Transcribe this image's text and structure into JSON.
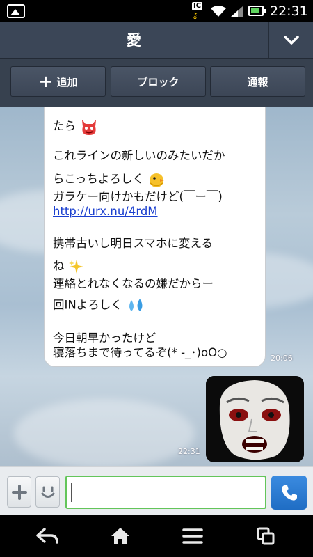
{
  "status_bar": {
    "ic_badge": "IC",
    "time": "22:31",
    "icons": [
      "image-notification-icon",
      "key-icon",
      "wifi-icon",
      "signal-icon",
      "battery-icon"
    ]
  },
  "header": {
    "title": "愛",
    "menu_icon": "chevron-down-icon"
  },
  "actions": {
    "add_label": "追加",
    "block_label": "ブロック",
    "report_label": "通報"
  },
  "messages": [
    {
      "side": "left",
      "lines": [
        "たら",
        "これラインの新しいのみたいだか",
        "らこっちよろしく",
        "ガラケー向けかもだけど(￣ー￣)",
        "http://urx.nu/4rdM",
        "携帯古いし明日スマホに変える",
        "ね",
        "連絡とれなくなるの嫌だからー",
        "回INよろしく",
        "今日朝早かったけど",
        "寝落ちまで待ってるぞ(* -_･)oO○"
      ],
      "time": "20:06"
    },
    {
      "side": "right",
      "type": "image",
      "time": "22:31"
    }
  ],
  "composer": {
    "input_value": "",
    "plus_icon": "plus-icon",
    "sticker_icon": "smiley-icon",
    "call_icon": "phone-icon"
  },
  "nav": {
    "icons": [
      "back-icon",
      "home-icon",
      "menu-icon",
      "recent-apps-icon"
    ]
  },
  "colors": {
    "header_bg": "#3b4657",
    "input_border": "#63c55a",
    "call_button": "#2b7bd4",
    "link": "#1a3fcf"
  }
}
